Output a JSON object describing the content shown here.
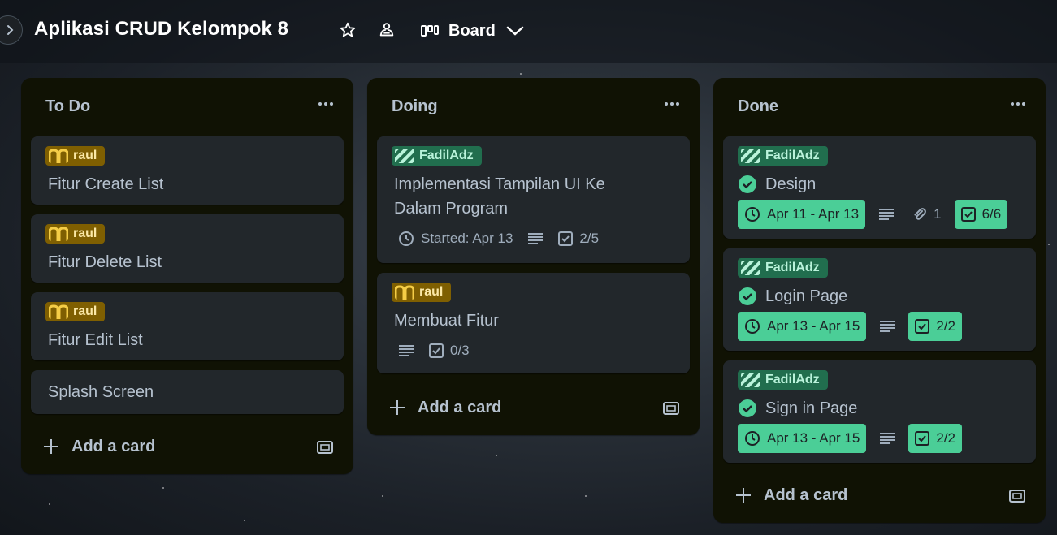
{
  "board": {
    "title": "Aplikasi CRUD Kelompok 8",
    "view_label": "Board"
  },
  "icons": {
    "sidebar_toggle": "chevron-right-icon",
    "star": "star-icon",
    "visibility": "team-visibility-icon",
    "view": "board-view-icon",
    "view_dropdown": "chevron-down-icon"
  },
  "colors": {
    "label_yellow": "#7f5f01",
    "label_green": "#216e4e",
    "badge_complete": "#4bce97",
    "list_bg": "#101204",
    "card_bg": "#22272b"
  },
  "add_card_label": "Add a card",
  "lists": [
    {
      "title": "To Do",
      "cards": [
        {
          "label": "raul",
          "title": "Fitur Create List"
        },
        {
          "label": "raul",
          "title": "Fitur Delete List"
        },
        {
          "label": "raul",
          "title": "Fitur Edit List"
        },
        {
          "title": "Splash Screen"
        }
      ]
    },
    {
      "title": "Doing",
      "cards": [
        {
          "label": "FadilAdz",
          "title_line1": "Implementasi Tampilan UI Ke",
          "title_line2": "Dalam Program",
          "started": "Started: Apr 13",
          "checklist": "2/5"
        },
        {
          "label": "raul",
          "title": "Membuat Fitur",
          "checklist": "0/3"
        }
      ]
    },
    {
      "title": "Done",
      "cards": [
        {
          "label": "FadilAdz",
          "title": "Design",
          "dates": "Apr 11 - Apr 13",
          "attachments": "1",
          "checklist": "6/6"
        },
        {
          "label": "FadilAdz",
          "title": "Login Page",
          "dates": "Apr 13 - Apr 15",
          "checklist": "2/2"
        },
        {
          "label": "FadilAdz",
          "title": "Sign in Page",
          "dates": "Apr 13 - Apr 15",
          "checklist": "2/2"
        }
      ]
    }
  ]
}
